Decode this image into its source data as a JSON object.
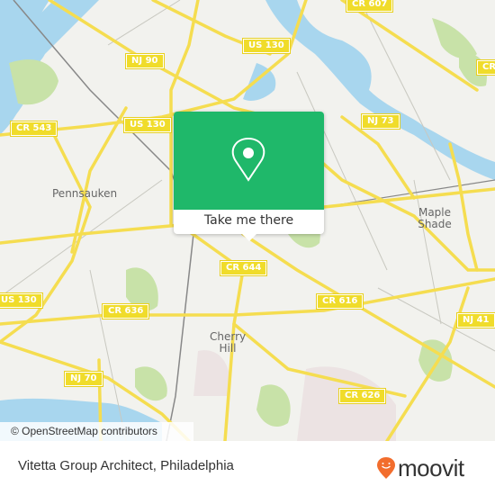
{
  "map": {
    "road_labels": [
      {
        "text": "CR 607"
      },
      {
        "text": "US 130"
      },
      {
        "text": "NJ 90"
      },
      {
        "text": "NJ 73"
      },
      {
        "text": "CR 543"
      },
      {
        "text": "US 130"
      },
      {
        "text": "CR"
      },
      {
        "text": "CR 644"
      },
      {
        "text": "CR 616"
      },
      {
        "text": "NJ 41"
      },
      {
        "text": "US 130"
      },
      {
        "text": "CR 636"
      },
      {
        "text": "NJ 70"
      },
      {
        "text": "CR 626"
      }
    ],
    "places": [
      {
        "name": "Pennsauken"
      },
      {
        "name": "Maple Shade"
      },
      {
        "name": "Cherry Hill"
      }
    ],
    "colors": {
      "land": "#f2f2ee",
      "water": "#a8d6ee",
      "park": "#c8e2a8",
      "road": "#f5dd50"
    }
  },
  "popup": {
    "button_label": "Take me there",
    "icon": "map-pin-icon",
    "color": "#1fb86a"
  },
  "attribution": "© OpenStreetMap contributors",
  "footer": {
    "title": "Vitetta Group Architect, Philadelphia",
    "brand": "moovit",
    "brand_color": "#f26d2d"
  }
}
